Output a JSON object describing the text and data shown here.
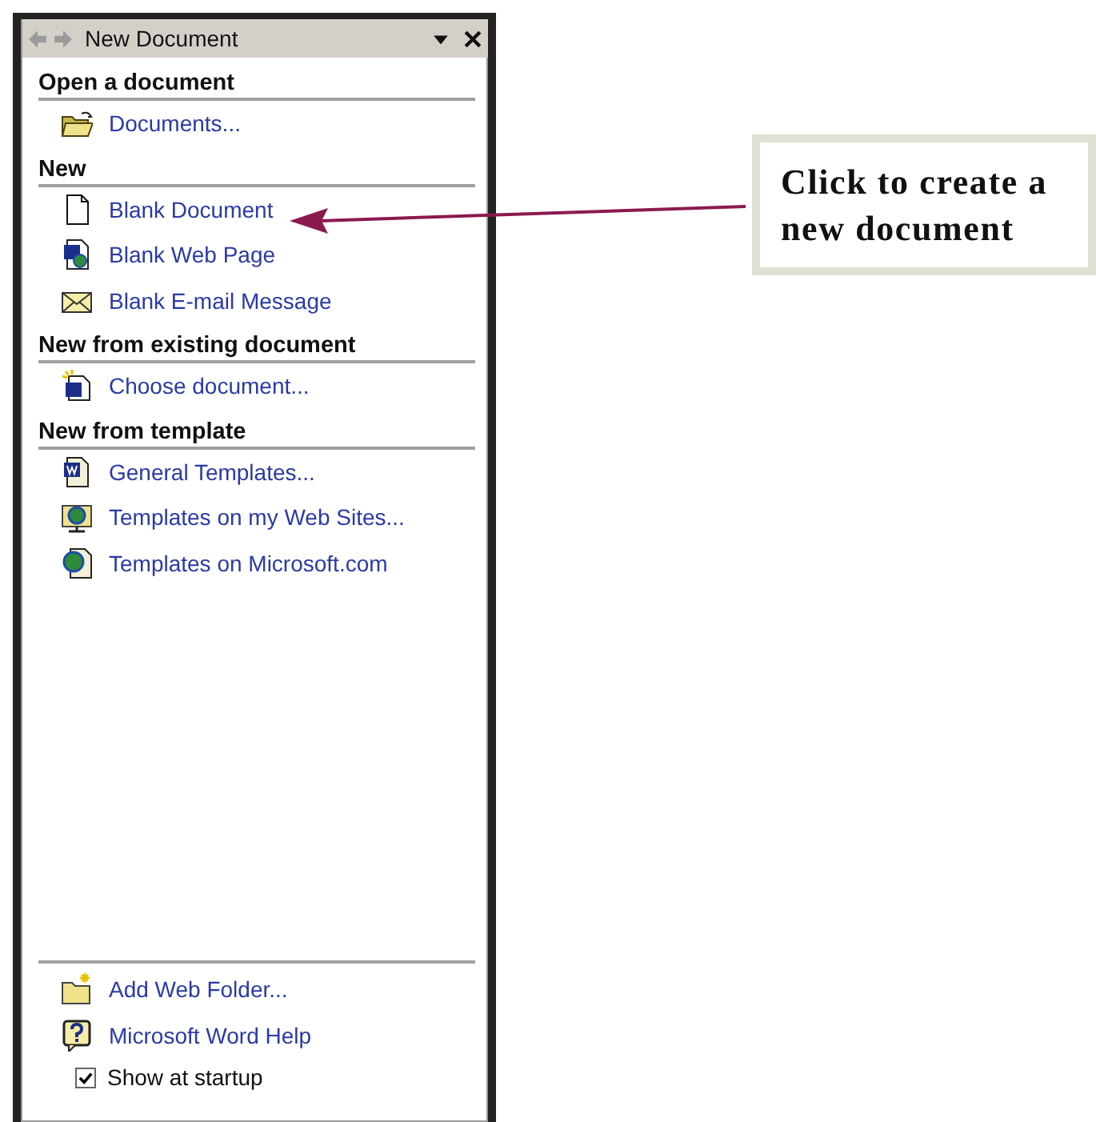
{
  "window": {
    "title": "New Document"
  },
  "sections": [
    {
      "heading": "Open a document",
      "items": [
        {
          "kind": "folder",
          "label": "Documents..."
        }
      ]
    },
    {
      "heading": "New",
      "items": [
        {
          "kind": "page",
          "label": "Blank Document"
        },
        {
          "kind": "web-page",
          "label": "Blank Web Page"
        },
        {
          "kind": "mail",
          "label": "Blank E-mail Message"
        }
      ]
    },
    {
      "heading": "New from existing document",
      "items": [
        {
          "kind": "new-doc",
          "label": "Choose document..."
        }
      ]
    },
    {
      "heading": "New from template",
      "items": [
        {
          "kind": "doc",
          "label": "General Templates..."
        },
        {
          "kind": "web-folder",
          "label": "Templates on my Web Sites..."
        },
        {
          "kind": "globe-doc",
          "label": "Templates on Microsoft.com"
        }
      ]
    }
  ],
  "footer": {
    "items": [
      {
        "kind": "new-folder",
        "label": "Add Web Folder..."
      },
      {
        "kind": "help",
        "label": "Microsoft Word Help"
      }
    ],
    "startup": {
      "label": "Show at startup",
      "checked": true
    }
  },
  "callout": {
    "text": "Click to create a new document"
  }
}
